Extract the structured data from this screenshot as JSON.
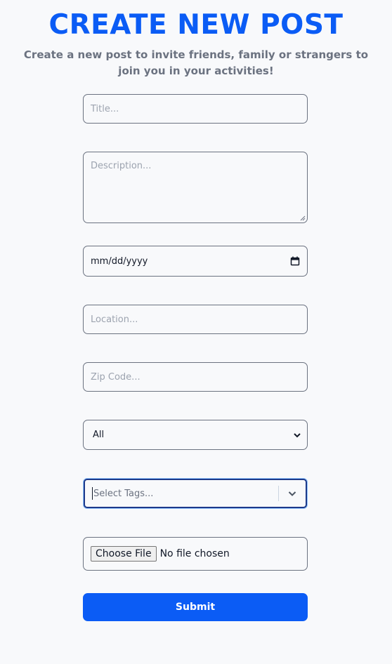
{
  "header": {
    "title": "CREATE NEW POST",
    "subtitle": "Create a new post to invite friends, family or strangers to join you in your activities!"
  },
  "form": {
    "title_placeholder": "Title...",
    "description_placeholder": "Description...",
    "date_value": "mm/dd/yyyy",
    "location_placeholder": "Location...",
    "zip_placeholder": "Zip Code...",
    "category_selected": "All",
    "tags_placeholder": "Select Tags...",
    "file_button_label": "Choose File",
    "file_status": "No file chosen",
    "submit_label": "Submit"
  },
  "icons": {
    "date": "calendar-icon",
    "select": "chevron-down-icon",
    "tags": "chevron-down-icon"
  },
  "colors": {
    "accent": "#0b5cf5",
    "subtitle": "#6b7280",
    "border": "#6b7280",
    "background": "#f8f9fb"
  }
}
